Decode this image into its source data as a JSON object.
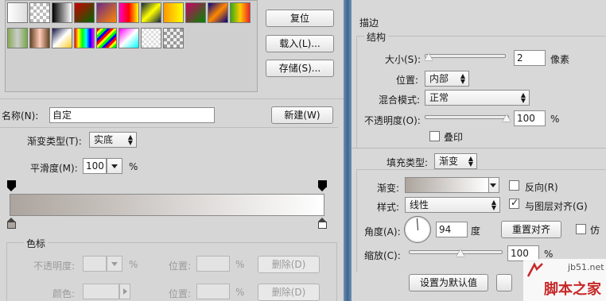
{
  "left": {
    "buttons": {
      "reset": "复位",
      "load": "载入(L)...",
      "save": "存储(S)...",
      "new": "新建(W)"
    },
    "name_label": "名称(N):",
    "name_value": "自定",
    "gradient_type_label": "渐变类型(T):",
    "gradient_type_value": "实底",
    "smoothness_label": "平滑度(M):",
    "smoothness_value": "100",
    "smoothness_unit": "%",
    "stops_group": "色标",
    "opacity_label": "不透明度:",
    "opacity_unit": "%",
    "position_label": "位置:",
    "position_unit": "%",
    "delete_label": "删除(D)",
    "color_label": "颜色:",
    "colors": {
      "gradient_start": "#aca49e",
      "gradient_end": "#ffffff"
    }
  },
  "right": {
    "title": "描边",
    "structure_label": "结构",
    "size_label": "大小(S):",
    "size_value": "2",
    "size_unit": "像素",
    "position_label": "位置:",
    "position_value": "内部",
    "blend_label": "混合模式:",
    "blend_value": "正常",
    "opacity_label": "不透明度(O):",
    "opacity_value": "100",
    "opacity_unit": "%",
    "overprint_label": "叠印",
    "fill_type_label": "填充类型:",
    "fill_type_value": "渐变",
    "gradient_label": "渐变:",
    "reverse_label": "反向(R)",
    "style_label": "样式:",
    "style_value": "线性",
    "align_label": "与图层对齐(G)",
    "angle_label": "角度(A):",
    "angle_value": "94",
    "angle_unit": "度",
    "reset_align_label": "重置对齐",
    "dither_label": "仿",
    "scale_label": "缩放(C):",
    "scale_value": "100",
    "scale_unit": "%",
    "default_button": "设置为默认值",
    "watermark_site": "jb51.net",
    "watermark_text": "脚本之家"
  }
}
